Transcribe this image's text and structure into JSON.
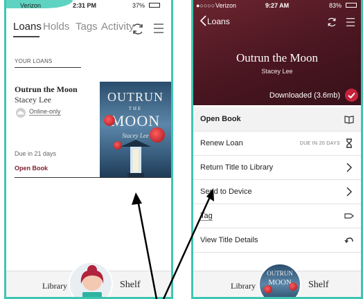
{
  "left_screen": {
    "status": {
      "carrier": "Verizon",
      "time": "2:31 PM",
      "battery": "37%"
    },
    "tabs": [
      "Loans",
      "Holds",
      "Tags",
      "Activity"
    ],
    "active_tab": "Loans",
    "section_label": "YOUR LOANS",
    "loan": {
      "title": "Outrun the Moon",
      "author": "Stacey Lee",
      "format": "Online-only",
      "due": "Due in 21 days",
      "action": "Open Book",
      "cover": {
        "line1": "OUTRUN",
        "line2": "THE",
        "line3": "MOON",
        "author": "Stacey Lee"
      }
    },
    "bottom_bar": {
      "library": "Library",
      "shelf": "Shelf"
    }
  },
  "right_screen": {
    "status": {
      "carrier": "Verizon",
      "time": "9:27 AM",
      "battery": "83%"
    },
    "back_label": "Loans",
    "title": "Outrun the Moon",
    "author": "Stacey Lee",
    "download_status": "Downloaded (3.6mb)",
    "menu": [
      {
        "label": "Open Book",
        "meta": "",
        "icon": "open-book-icon"
      },
      {
        "label": "Renew Loan",
        "meta": "DUE IN 20 DAYS",
        "icon": "hourglass-icon"
      },
      {
        "label": "Return Title to Library",
        "meta": "",
        "icon": "chevron-right-icon"
      },
      {
        "label": "Send to Device",
        "meta": "",
        "icon": "chevron-right-icon"
      },
      {
        "label": "Tag",
        "meta": "",
        "icon": "tag-icon"
      },
      {
        "label": "View Title Details",
        "meta": "",
        "icon": "undo-arrow-icon"
      }
    ],
    "thumb": {
      "line1": "OUTRUN",
      "line2": "MOON"
    },
    "bottom_bar": {
      "library": "Library",
      "shelf": "Shelf"
    }
  },
  "colors": {
    "frame": "#3ec6b2",
    "accent": "#7d1c2c",
    "hero": "#5a1c27",
    "badge": "#c6223c"
  }
}
